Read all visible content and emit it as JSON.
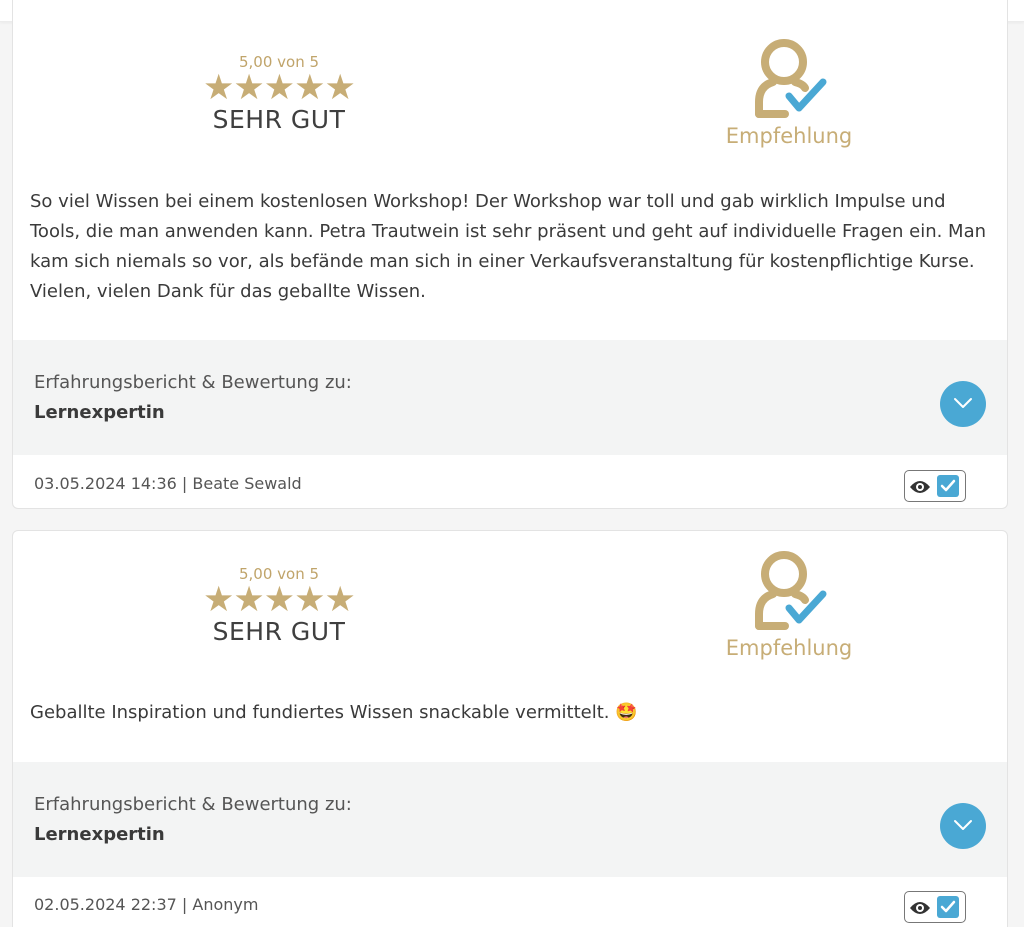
{
  "colors": {
    "accent_gold": "#c7ad76",
    "accent_blue": "#4aa8d4",
    "panel_grey": "#f3f4f4"
  },
  "icons": {
    "stars": "star-icon",
    "recommend": "person-check-icon",
    "expand": "chevron-down-icon",
    "visibility": "eye-icon",
    "checkbox": "checkbox-checked-icon"
  },
  "reviews": [
    {
      "score": "5,00 von 5",
      "stars": "★★★★★",
      "rating_value": 5,
      "verdict": "SEHR GUT",
      "recommend_label": "Empfehlung",
      "text": "So viel Wissen bei einem kostenlosen Workshop! Der Workshop war toll und gab wirklich Impulse und Tools, die man anwenden kann. Petra Trautwein ist sehr präsent und geht auf individuelle Fragen ein. Man kam sich niemals so vor, als befände man sich in einer Verkaufsveranstaltung für kostenpflichtige Kurse. Vielen, vielen Dank für das geballte Wissen.",
      "product_caption": "Erfahrungsbericht & Bewertung zu:",
      "product_name": "Lernexpertin",
      "meta": "03.05.2024 14:36 | Beate Sewald",
      "visible_checked": true
    },
    {
      "score": "5,00 von 5",
      "stars": "★★★★★",
      "rating_value": 5,
      "verdict": "SEHR GUT",
      "recommend_label": "Empfehlung",
      "text": "Geballte Inspiration und fundiertes Wissen snackable vermittelt. 🤩",
      "product_caption": "Erfahrungsbericht & Bewertung zu:",
      "product_name": "Lernexpertin",
      "meta": "02.05.2024 22:37 | Anonym",
      "visible_checked": true
    }
  ]
}
